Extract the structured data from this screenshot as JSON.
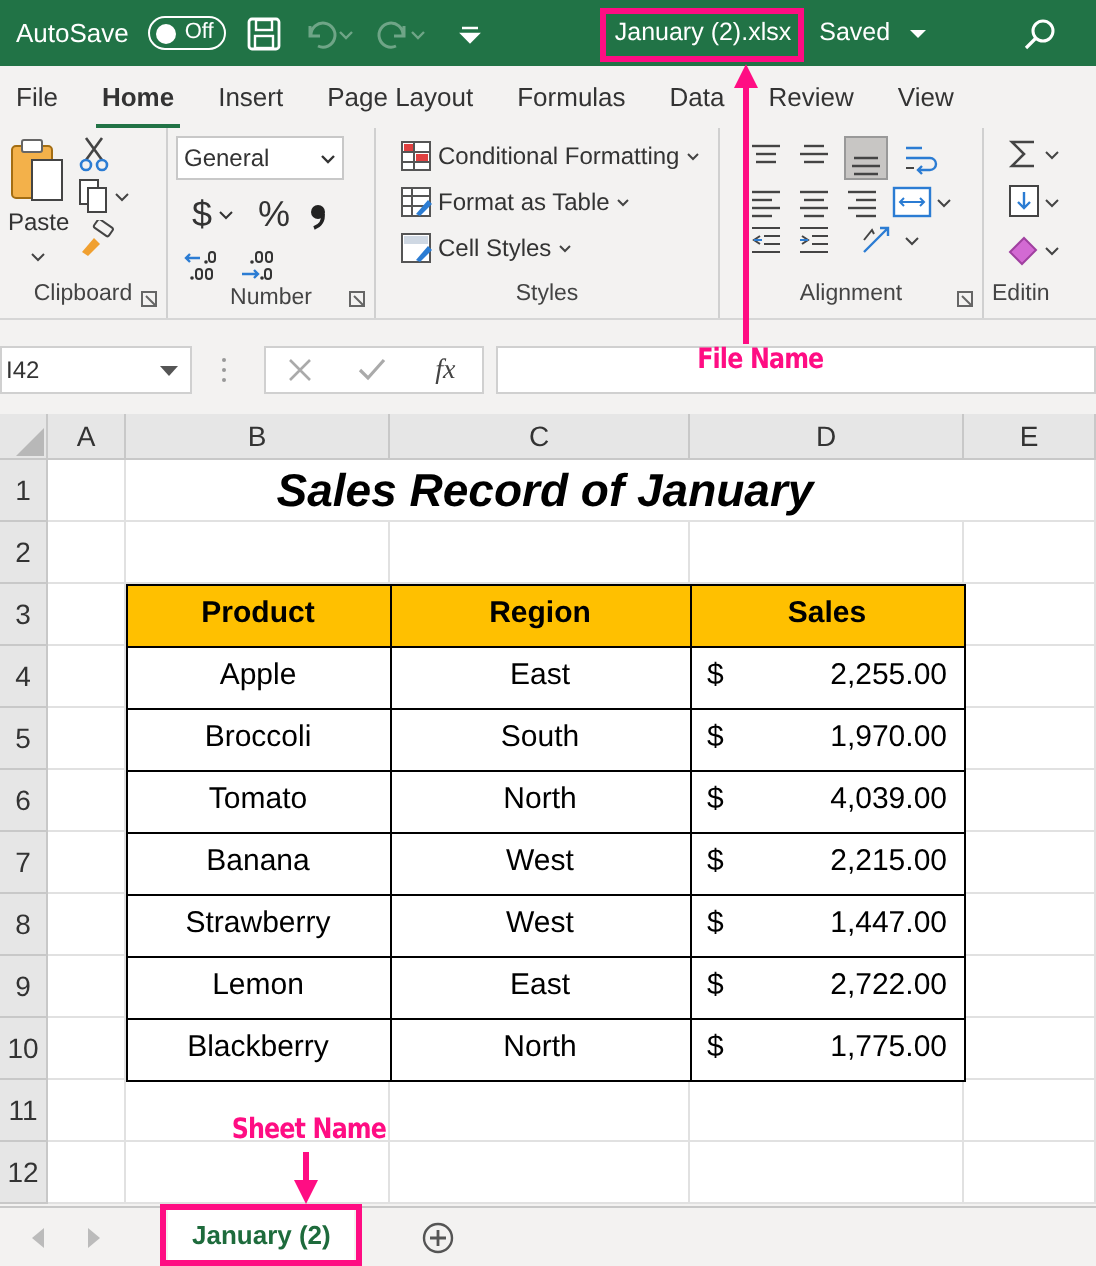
{
  "title_bar": {
    "autosave_label": "AutoSave",
    "autosave_toggle": {
      "label": "Off",
      "on": false
    },
    "file_name": "January (2).xlsx",
    "save_status": "Saved"
  },
  "menu_tabs": [
    {
      "label": "File",
      "selected": false
    },
    {
      "label": "Home",
      "selected": true
    },
    {
      "label": "Insert",
      "selected": false
    },
    {
      "label": "Page Layout",
      "selected": false
    },
    {
      "label": "Formulas",
      "selected": false
    },
    {
      "label": "Data",
      "selected": false
    },
    {
      "label": "Review",
      "selected": false
    },
    {
      "label": "View",
      "selected": false
    }
  ],
  "ribbon": {
    "paste_label": "Paste",
    "number_format": "General",
    "currency_symbol": "$",
    "percent_symbol": "%",
    "style_buttons": [
      "Conditional Formatting",
      "Format as Table",
      "Cell Styles"
    ],
    "group_labels": [
      "Clipboard",
      "Number",
      "Styles",
      "Alignment",
      "Editin"
    ]
  },
  "formula_bar": {
    "name_box": "I42",
    "function_label": "fx"
  },
  "sheet": {
    "columns": [
      "A",
      "B",
      "C",
      "D",
      "E"
    ],
    "rows": [
      "1",
      "2",
      "3",
      "4",
      "5",
      "6",
      "7",
      "8",
      "9",
      "10",
      "11",
      "12"
    ],
    "title": "Sales Record of January",
    "table": {
      "columns": [
        "Product",
        "Region",
        "Sales"
      ],
      "rows": [
        {
          "product": "Apple",
          "region": "East",
          "currency": "$",
          "sales": "2,255.00"
        },
        {
          "product": "Broccoli",
          "region": "South",
          "currency": "$",
          "sales": "1,970.00"
        },
        {
          "product": "Tomato",
          "region": "North",
          "currency": "$",
          "sales": "4,039.00"
        },
        {
          "product": "Banana",
          "region": "West",
          "currency": "$",
          "sales": "2,215.00"
        },
        {
          "product": "Strawberry",
          "region": "West",
          "currency": "$",
          "sales": "1,447.00"
        },
        {
          "product": "Lemon",
          "region": "East",
          "currency": "$",
          "sales": "2,722.00"
        },
        {
          "product": "Blackberry",
          "region": "North",
          "currency": "$",
          "sales": "1,775.00"
        }
      ]
    }
  },
  "sheet_tabs": [
    {
      "label": "January (2)",
      "selected": true
    }
  ],
  "annotations": [
    {
      "kind": "file",
      "label": "File Name"
    },
    {
      "kind": "sheet",
      "label": "Sheet Name"
    }
  ]
}
